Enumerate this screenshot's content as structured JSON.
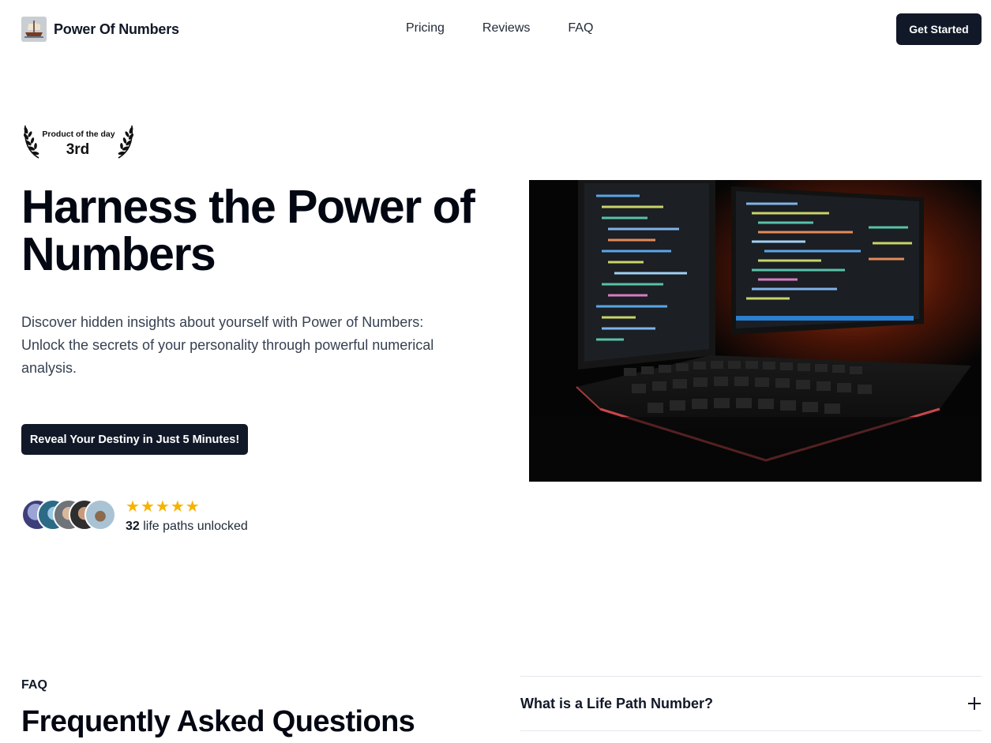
{
  "header": {
    "brand_name": "Power Of Numbers",
    "nav": [
      "Pricing",
      "Reviews",
      "FAQ"
    ],
    "cta_label": "Get Started"
  },
  "award": {
    "title": "Product of the day",
    "rank": "3rd"
  },
  "hero": {
    "title": "Harness the Power of Numbers",
    "description": "Discover hidden insights about yourself with Power of Numbers: Unlock the secrets of your personality through powerful numerical analysis.",
    "cta_label": "Reveal Your Destiny in Just 5 Minutes!",
    "rating_stars": 5,
    "unlocked_count": "32",
    "unlocked_text": "life paths unlocked",
    "image_icon": "computer-monitors-keyboard-photo"
  },
  "faq": {
    "eyebrow": "FAQ",
    "title": "Frequently Asked Questions",
    "items": [
      {
        "question": "What is a Life Path Number?"
      }
    ]
  },
  "colors": {
    "primary_button": "#111827",
    "star": "#f5b301",
    "text_dark": "#030712"
  }
}
